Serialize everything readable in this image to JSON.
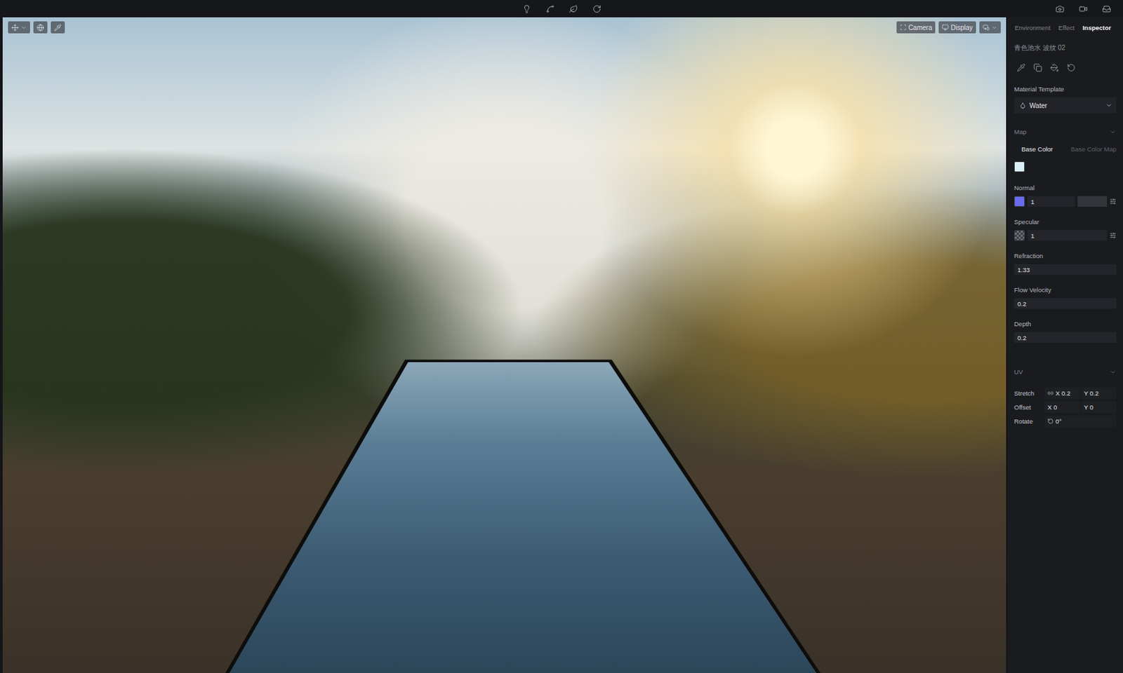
{
  "viewport": {
    "buttons": [
      {
        "label": "Camera"
      },
      {
        "label": "Display"
      }
    ]
  },
  "panel": {
    "tabs": [
      {
        "label": "Environment",
        "selected": false
      },
      {
        "label": "Effect",
        "selected": false
      },
      {
        "label": "Inspector",
        "selected": true
      }
    ],
    "title": "青色池水 波纹 02",
    "material_template": {
      "label": "Material Template",
      "value": "Water"
    },
    "map": {
      "label": "Map",
      "expanded": true,
      "tabs": [
        {
          "label": "Base Color",
          "selected": true
        },
        {
          "label": "Base Color Map",
          "selected": false
        }
      ],
      "base_color": "#d9f0f8",
      "fields": [
        {
          "label": "Normal",
          "kind": "swatch",
          "value": "1",
          "color": "#6b6bf0"
        },
        {
          "label": "Specular",
          "kind": "texture",
          "value": "1"
        },
        {
          "label": "Refraction",
          "kind": "number",
          "value": "1.33"
        },
        {
          "label": "Flow Velocity",
          "kind": "number",
          "value": "0.2"
        },
        {
          "label": "Depth",
          "kind": "number",
          "value": "0.2"
        }
      ]
    },
    "uv": {
      "label": "UV",
      "expanded": true,
      "rows": [
        {
          "label": "Stretch",
          "kind": "pair",
          "x": "X 0.2",
          "y": "Y 0.2"
        },
        {
          "label": "Offset",
          "kind": "pair",
          "x": "X 0",
          "y": "Y 0"
        },
        {
          "label": "Rotate",
          "kind": "angle",
          "value": "0°"
        }
      ]
    }
  }
}
